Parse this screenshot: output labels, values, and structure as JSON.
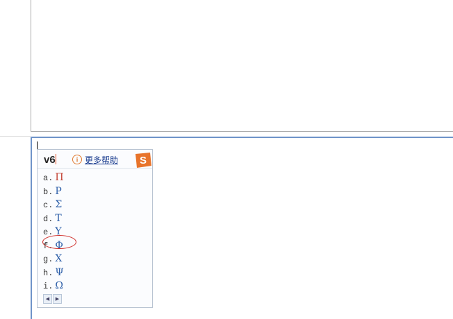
{
  "ime": {
    "pinyin": "v6",
    "help_label": "更多帮助",
    "logo_letter": "S",
    "candidates": [
      {
        "key": "a.",
        "char": "Π"
      },
      {
        "key": "b.",
        "char": "Ρ"
      },
      {
        "key": "c.",
        "char": "Σ"
      },
      {
        "key": "d.",
        "char": "Τ"
      },
      {
        "key": "e.",
        "char": "Υ"
      },
      {
        "key": "f.",
        "char": "Φ"
      },
      {
        "key": "g.",
        "char": "Χ"
      },
      {
        "key": "h.",
        "char": "Ψ"
      },
      {
        "key": "i.",
        "char": "Ω"
      }
    ],
    "pager": {
      "prev": "◀",
      "next": "▶"
    }
  },
  "colors": {
    "accent_orange": "#e8742b",
    "highlight_red": "#d0312d",
    "link_blue": "#1a3c8f"
  }
}
